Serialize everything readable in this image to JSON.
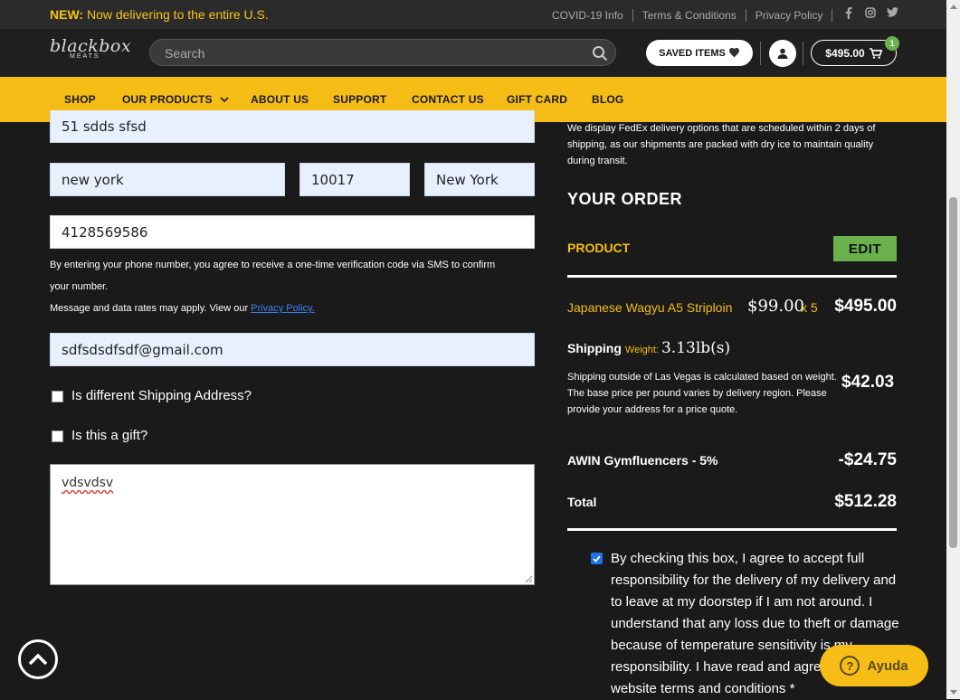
{
  "announcement": {
    "prefix": "NEW:",
    "text": " Now delivering to the entire U.S."
  },
  "top_links": [
    "COVID-19 Info",
    "Terms & Conditions",
    "Privacy Policy"
  ],
  "social_icons": [
    "facebook-icon",
    "instagram-icon",
    "twitter-icon"
  ],
  "logo": {
    "line1": "blackbox",
    "line2": "MEATS"
  },
  "search": {
    "placeholder": "Search",
    "value": ""
  },
  "saved_items_label": "SAVED ITEMS",
  "cart": {
    "amount": "$495.00",
    "count": "1"
  },
  "nav": [
    "SHOP",
    "OUR PRODUCTS",
    "ABOUT US",
    "SUPPORT",
    "CONTACT US",
    "GIFT CARD",
    "BLOG"
  ],
  "form": {
    "address": "51 sdds sfsd",
    "city": "new york",
    "zip": "10017",
    "state": "New York",
    "phone": "4128569586",
    "phone_note_1": "By entering your phone number, you agree to receive a one-time verification code via SMS to confirm",
    "phone_note_2": "your number.",
    "phone_note_3": "Message and data rates may apply. View our ",
    "privacy_link": "Privacy Policy.",
    "email": "sdfsdsdfsdf@gmail.com",
    "different_shipping_label": "Is different Shipping Address?",
    "gift_label": "Is this a gift?",
    "notes": "vdsvdsv"
  },
  "order": {
    "delivery_note": "We display FedEx delivery options that are scheduled within 2 days of shipping, as our shipments are packed with dry ice to maintain quality during transit.",
    "heading": "YOUR ORDER",
    "product_header": "PRODUCT",
    "edit_label": "EDIT",
    "item": {
      "name": "Japanese Wagyu A5 Striploin",
      "price": "$99.00",
      "qty": "x 5",
      "total": "$495.00"
    },
    "shipping": {
      "label": "Shipping",
      "weight_label": "Weight:",
      "weight_value": "3.13lb(s)",
      "description": "Shipping outside of Las Vegas is calculated based on weight. The base price per pound varies by delivery region. Please provide your address for a price quote.",
      "amount": "$42.03"
    },
    "discount": {
      "label": "AWIN Gymfluencers - 5%",
      "amount": "-$24.75"
    },
    "total": {
      "label": "Total",
      "amount": "$512.28"
    },
    "agreement": "By checking this box, I agree to accept full responsibility for the delivery of my delivery and to leave at my doorstep if I am not around. I understand that any loss due to theft or damage because of temperature sensitivity is my responsibility. I have read and agree to the website terms and conditions *"
  },
  "help_button": "Ayuda",
  "colors": {
    "accent": "#f5bd16",
    "edit_green": "#6ab04c",
    "background": "#1a1a1a"
  }
}
